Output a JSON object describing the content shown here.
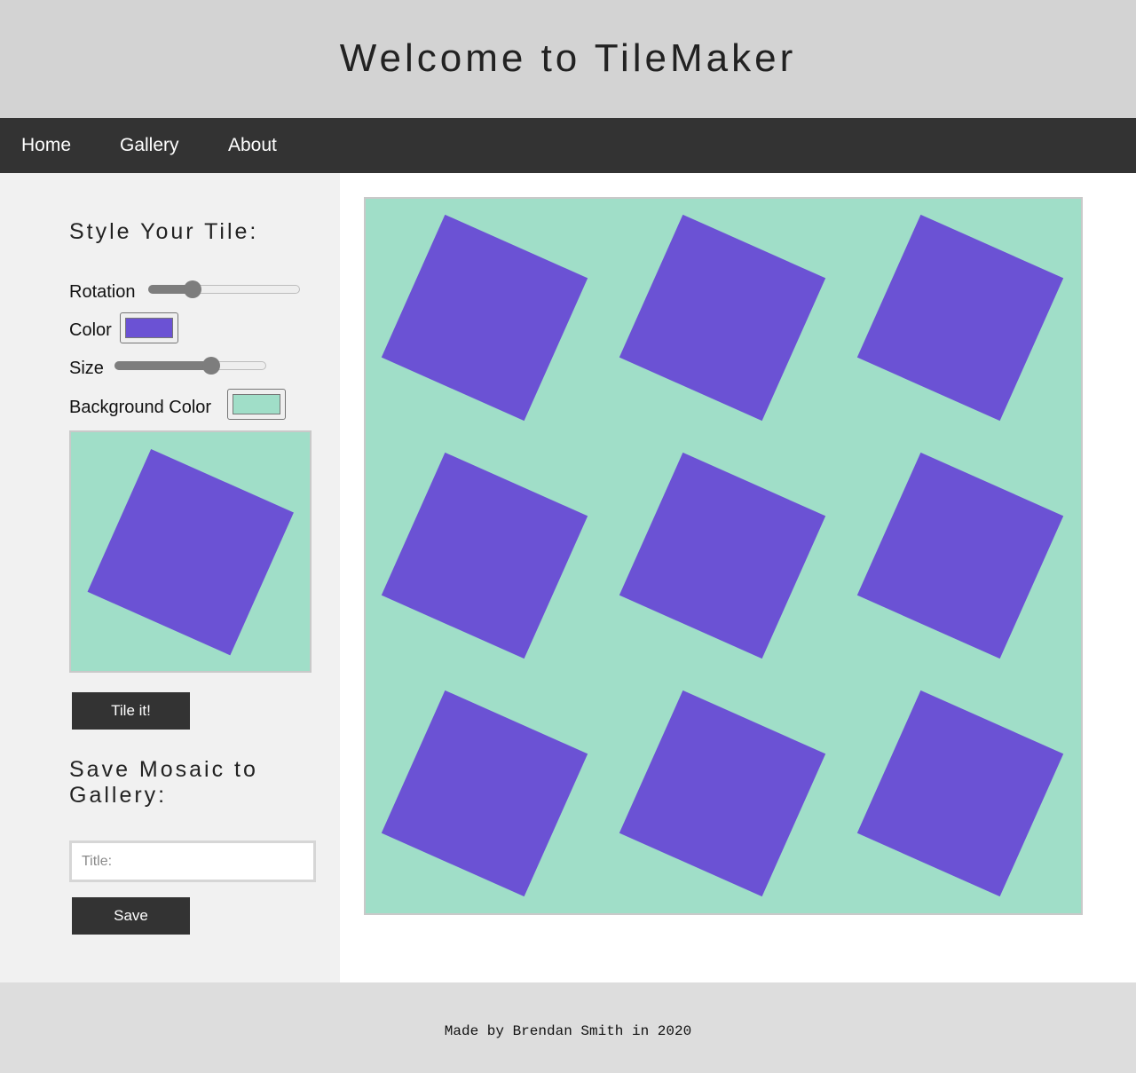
{
  "header": {
    "title": "Welcome to TileMaker"
  },
  "nav": {
    "items": [
      "Home",
      "Gallery",
      "About"
    ]
  },
  "sidebar": {
    "style_heading": "Style Your Tile:",
    "rotation": {
      "label": "Rotation",
      "value": 0.29
    },
    "color": {
      "label": "Color",
      "value": "#6b52d4"
    },
    "size": {
      "label": "Size",
      "value": 0.64
    },
    "background_color": {
      "label": "Background Color",
      "value": "#a0dec8"
    },
    "tile_button_label": "Tile it!",
    "save_heading": "Save Mosaic to Gallery:",
    "title_input": {
      "placeholder": "Title:",
      "value": ""
    },
    "save_button_label": "Save"
  },
  "tile": {
    "rotation_deg": 24,
    "color": "#6b52d4",
    "background": "#a0dec8"
  },
  "mosaic": {
    "rows": 3,
    "columns": 3
  },
  "footer": {
    "text": "Made by Brendan Smith in 2020"
  }
}
